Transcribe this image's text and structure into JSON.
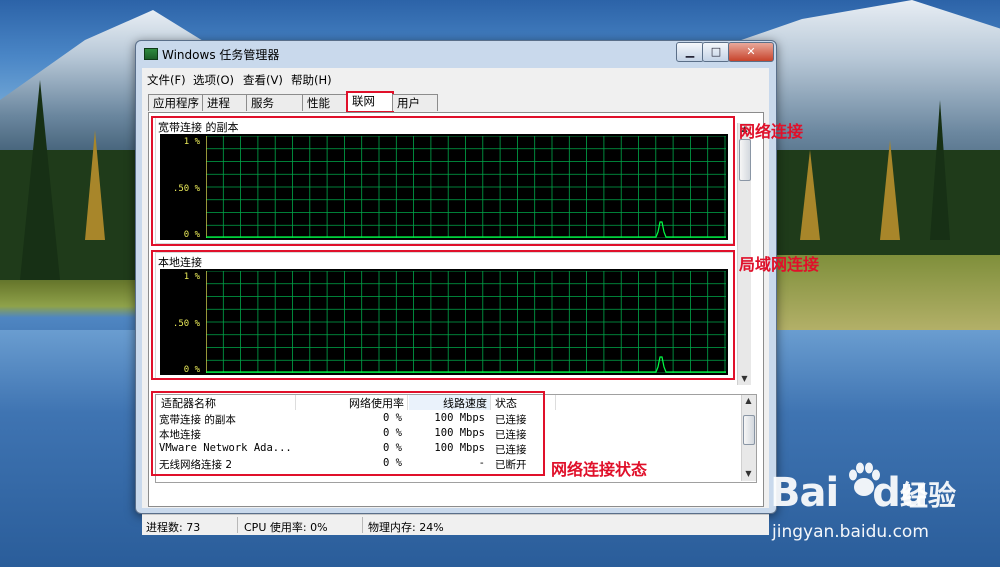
{
  "window": {
    "title": "Windows 任务管理器",
    "controls": {
      "minimize": "▁",
      "maximize": "□",
      "close": "✕"
    }
  },
  "menu": [
    "文件(F)",
    "选项(O)",
    "查看(V)",
    "帮助(H)"
  ],
  "tabs": [
    {
      "label": "应用程序",
      "active": false
    },
    {
      "label": "进程",
      "active": false
    },
    {
      "label": "服务",
      "active": false
    },
    {
      "label": "性能",
      "active": false
    },
    {
      "label": "联网",
      "active": true
    },
    {
      "label": "用户",
      "active": false
    }
  ],
  "graphs": [
    {
      "title": "宽带连接 的副本",
      "y_labels": [
        "1 %",
        ".50 %",
        "0 %"
      ]
    },
    {
      "title": "本地连接",
      "y_labels": [
        "1 %",
        ".50 %",
        "0 %"
      ]
    }
  ],
  "adapter_table": {
    "columns": [
      "适配器名称",
      "网络使用率",
      "线路速度",
      "状态"
    ],
    "rows": [
      {
        "name": "宽带连接 的副本",
        "usage": "0 %",
        "speed": "100 Mbps",
        "status": "已连接"
      },
      {
        "name": "本地连接",
        "usage": "0 %",
        "speed": "100 Mbps",
        "status": "已连接"
      },
      {
        "name": "VMware Network Ada...",
        "usage": "0 %",
        "speed": "100 Mbps",
        "status": "已连接"
      },
      {
        "name": "无线网络连接 2",
        "usage": "0 %",
        "speed": "-",
        "status": "已断开"
      }
    ]
  },
  "status_bar": {
    "processes": "进程数: 73",
    "cpu": "CPU 使用率: 0%",
    "memory": "物理内存: 24%"
  },
  "annotations": {
    "network": "网络连接",
    "lan": "局域网连接",
    "status": "网络连接状态"
  },
  "watermark": {
    "brand": "Bai",
    "brand_suffix": "du",
    "product": "经验",
    "url": "jingyan.baidu.com"
  },
  "colors": {
    "graph_bg": "#000000",
    "grid": "#00a84a",
    "trace": "#00ff44",
    "axis_text": "#e8e858",
    "annotation": "#e0102a"
  }
}
